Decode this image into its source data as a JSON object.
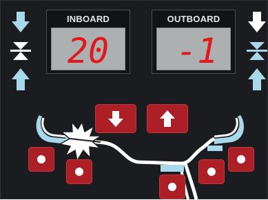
{
  "inboard": {
    "label": "INBOARD",
    "value": "20"
  },
  "outboard": {
    "label": "OUTBOARD",
    "value": "-1"
  },
  "colors": {
    "panel": "#1b1c20",
    "lcd_background": "#adb0b1",
    "digit": "#e0181f",
    "button": "#ad1f26",
    "icon_light_blue": "#a9d8ea",
    "icon_white": "#ffffff"
  },
  "icons": {
    "left_side": [
      "arrow-down-icon",
      "clamp-center-icon",
      "arrow-up-icon"
    ],
    "right_side": [
      "arrow-down-icon",
      "clamp-center-icon",
      "arrow-up-icon"
    ],
    "center_buttons": [
      "arrow-down-icon",
      "arrow-up-icon"
    ],
    "position_buttons": [
      "dot-icon"
    ],
    "highlight": "burst-marker-icon"
  }
}
